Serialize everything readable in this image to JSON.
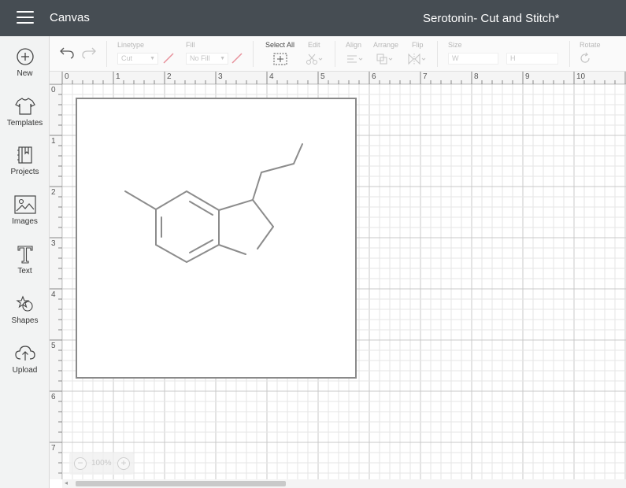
{
  "header": {
    "app_title": "Canvas",
    "project_title": "Serotonin- Cut and Stitch*"
  },
  "sidebar": {
    "items": [
      {
        "label": "New",
        "icon": "plus-circle-icon"
      },
      {
        "label": "Templates",
        "icon": "tshirt-icon"
      },
      {
        "label": "Projects",
        "icon": "book-icon"
      },
      {
        "label": "Images",
        "icon": "image-icon"
      },
      {
        "label": "Text",
        "icon": "text-icon"
      },
      {
        "label": "Shapes",
        "icon": "shapes-icon"
      },
      {
        "label": "Upload",
        "icon": "cloud-upload-icon"
      }
    ]
  },
  "toolbar": {
    "linetype_label": "Linetype",
    "linetype_value": "Cut",
    "fill_label": "Fill",
    "fill_value": "No Fill",
    "select_all_label": "Select All",
    "edit_label": "Edit",
    "align_label": "Align",
    "arrange_label": "Arrange",
    "flip_label": "Flip",
    "size_label": "Size",
    "width_label": "W",
    "height_label": "H",
    "rotate_label": "Rotate"
  },
  "ruler": {
    "horizontal": [
      "0",
      "1",
      "2",
      "3",
      "4",
      "5",
      "6",
      "7",
      "8",
      "9",
      "10"
    ],
    "vertical": [
      "0",
      "1",
      "2",
      "3",
      "4",
      "5",
      "6",
      "7"
    ]
  },
  "zoom": {
    "value": "100%",
    "minus": "−",
    "plus": "+"
  },
  "colors": {
    "header_bg": "#464d53",
    "sidebar_bg": "#f2f3f3",
    "grid_line": "#dcdcdc",
    "mat_border": "#8a8a8a",
    "molecule_stroke": "#8c8c8c"
  }
}
